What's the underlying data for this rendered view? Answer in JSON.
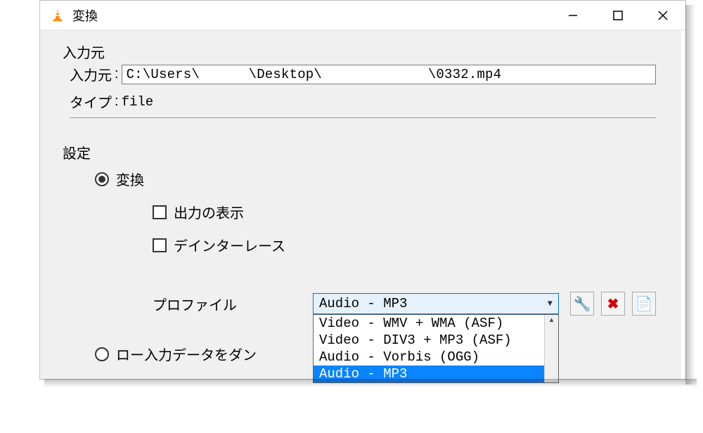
{
  "window": {
    "title": "変換"
  },
  "source_group": {
    "title": "入力元",
    "source_label": "入力元",
    "source_value": "C:\\Users\\      \\Desktop\\             \\0332.mp4",
    "type_label": "タイプ",
    "type_value": "file"
  },
  "settings_group": {
    "title": "設定",
    "radio_convert": "変換",
    "check_display_output": "出力の表示",
    "check_deinterlace": "デインターレース",
    "profile_label": "プロファイル",
    "profile_selected": "Audio - MP3",
    "profile_options": {
      "opt0": "Video - WMV + WMA (ASF)",
      "opt1": "Video - DIV3 + MP3 (ASF)",
      "opt2": "Audio - Vorbis (OGG)",
      "opt3": "Audio - MP3"
    },
    "radio_raw_partial": "ロー入力データをダン"
  },
  "icons": {
    "wrench": "🔧",
    "delete": "✖",
    "new": "📄"
  }
}
